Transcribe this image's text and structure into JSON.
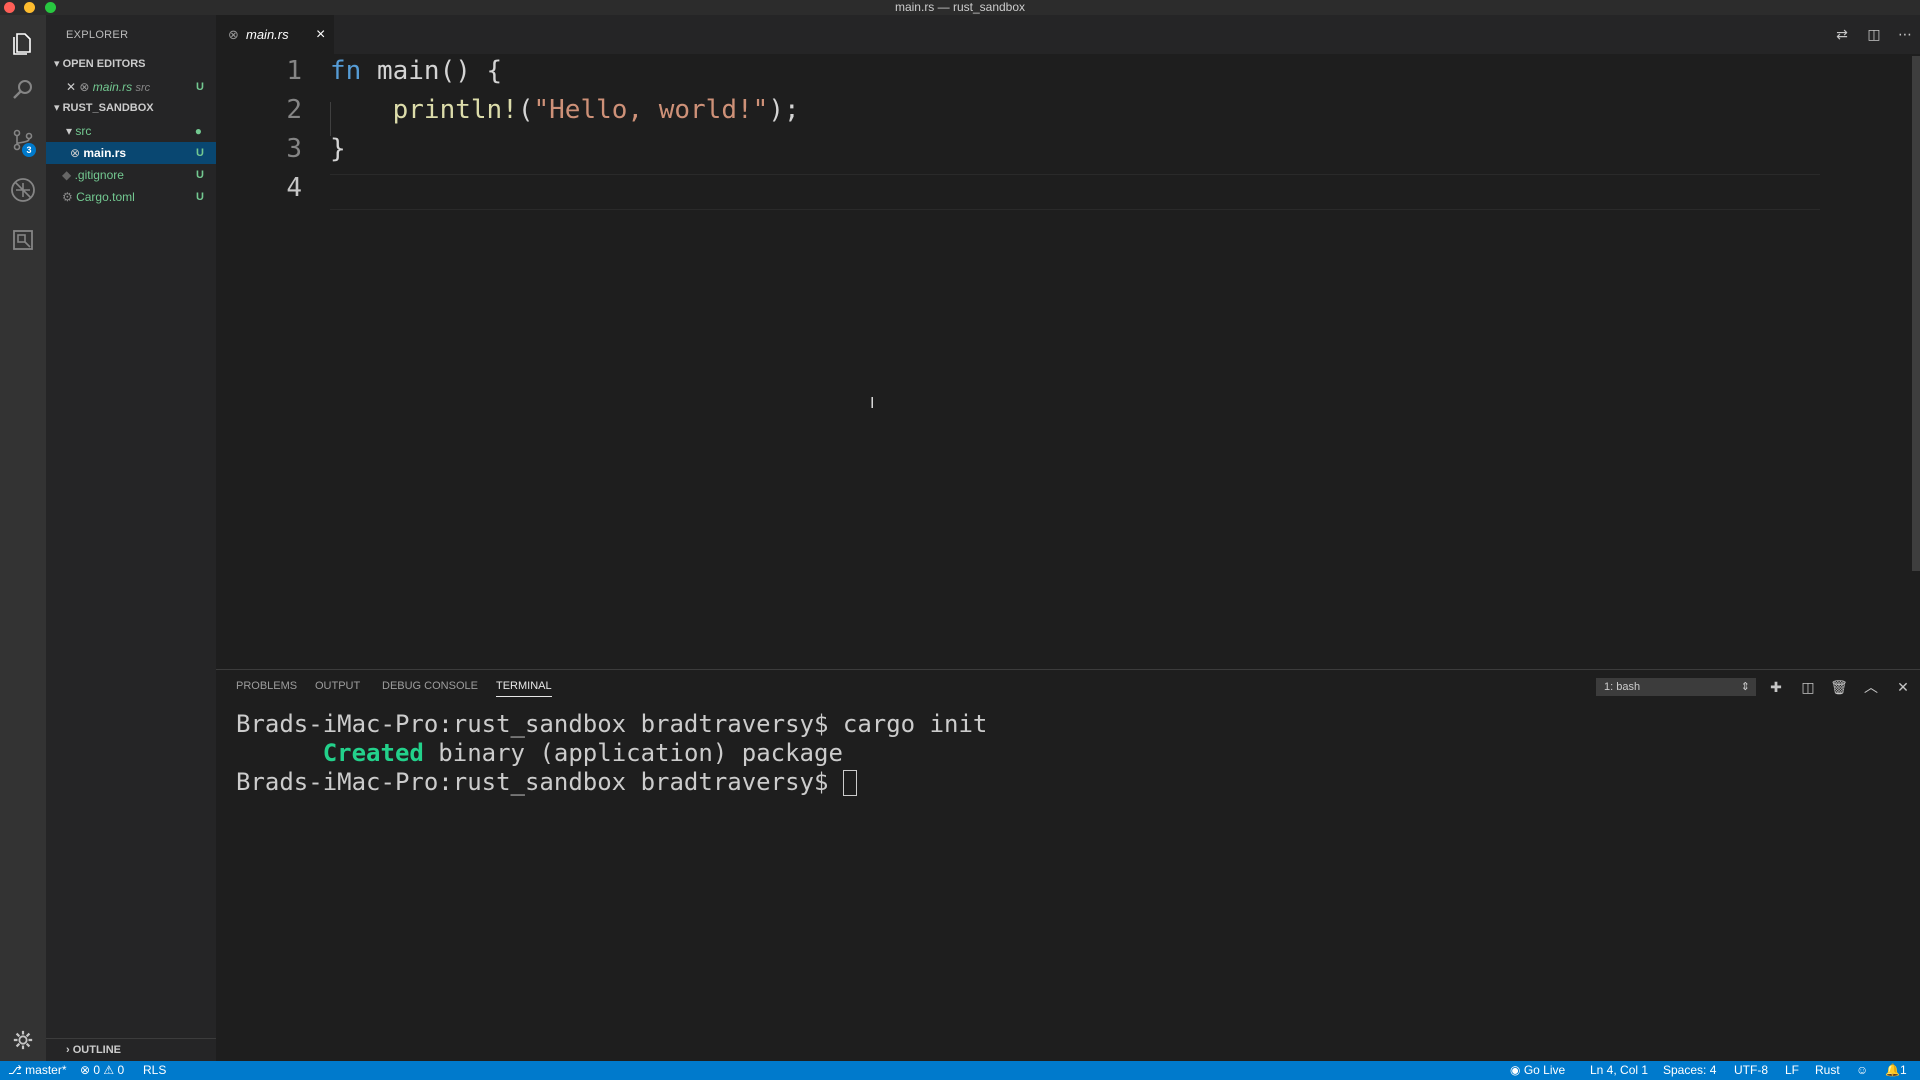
{
  "window": {
    "title": "main.rs — rust_sandbox"
  },
  "activity": {
    "scm_badge": "3"
  },
  "sidebar": {
    "title": "EXPLORER",
    "open_editors_label": "OPEN EDITORS",
    "open_editor": {
      "name": "main.rs",
      "path": "src",
      "status": "U"
    },
    "project_label": "RUST_SANDBOX",
    "tree": [
      {
        "name": "src",
        "status": ""
      },
      {
        "name": "main.rs",
        "status": "U"
      },
      {
        "name": ".gitignore",
        "status": "U"
      },
      {
        "name": "Cargo.toml",
        "status": "U"
      }
    ],
    "outline_label": "OUTLINE"
  },
  "editor": {
    "tab_label": "main.rs",
    "tab_close": "×",
    "line_numbers": [
      "1",
      "2",
      "3",
      "4"
    ],
    "code": {
      "l1_kw": "fn",
      "l1_rest": " main() {",
      "l2_fn": "    println!",
      "l2_open": "(",
      "l2_str": "\"Hello, world!\"",
      "l2_close": ");",
      "l3": "}"
    }
  },
  "panel": {
    "tabs": [
      "PROBLEMS",
      "OUTPUT",
      "DEBUG CONSOLE",
      "TERMINAL"
    ],
    "terminal_select": "1: bash",
    "terminal_lines": {
      "l1": "Brads-iMac-Pro:rust_sandbox bradtraversy$ cargo init",
      "l2_created": "Created",
      "l2_rest": " binary (application) package",
      "l3": "Brads-iMac-Pro:rust_sandbox bradtraversy$ "
    }
  },
  "status": {
    "branch": "master*",
    "errors": "0",
    "warnings": "0",
    "rls": "RLS",
    "go_live": "Go Live",
    "position": "Ln 4, Col 1",
    "spaces": "Spaces: 4",
    "encoding": "UTF-8",
    "eol": "LF",
    "language": "Rust",
    "notifications": "1"
  }
}
